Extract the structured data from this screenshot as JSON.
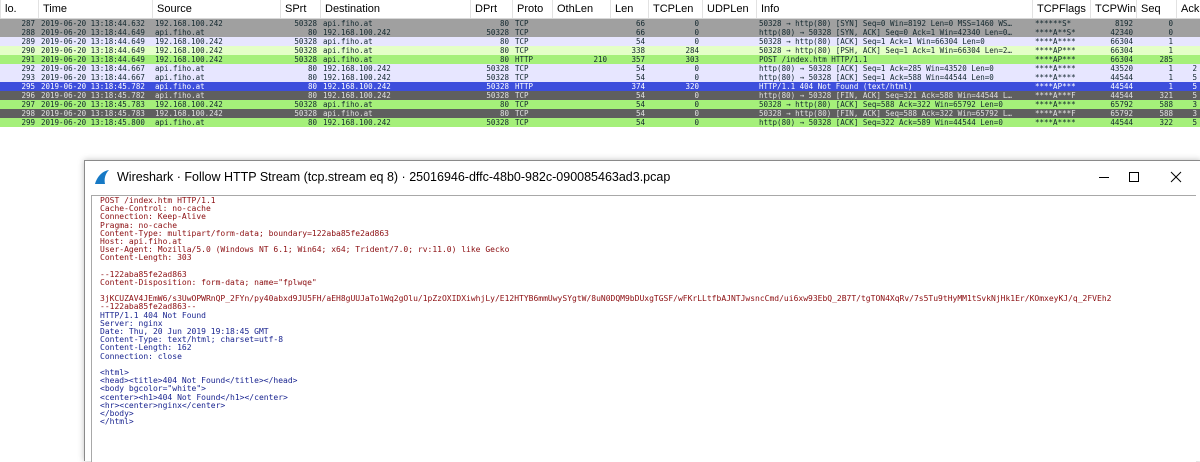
{
  "colors": {
    "client_text": "#8b0d10",
    "server_text": "#1a2590",
    "selected_row": "#3d4edc",
    "http_row_green": "#a5f07a",
    "tcp_row": "#e7e6ff",
    "handshake_row": "#a0a0a0",
    "fin_row": "#5f5f5f"
  },
  "packet_list": {
    "columns": [
      "lo.",
      "Time",
      "Source",
      "SPrt",
      "Destination",
      "DPrt",
      "Proto",
      "OthLen",
      "Len",
      "TCPLen",
      "UDPLen",
      "Info",
      "TCPFlags",
      "TCPWin",
      "Seq",
      "Ack"
    ],
    "rows": [
      {
        "style": "handshake",
        "cells": [
          "287",
          "2019-06-20 13:18:44.632",
          "192.168.100.242",
          "50328",
          "api.fiho.at",
          "80",
          "TCP",
          "",
          "66",
          "0",
          "",
          "50328 → http(80) [SYN] Seq=0 Win=8192 Len=0 MSS=1460 WS…",
          "******S*",
          "8192",
          "0",
          ""
        ]
      },
      {
        "style": "handshake",
        "cells": [
          "288",
          "2019-06-20 13:18:44.649",
          "api.fiho.at",
          "80",
          "192.168.100.242",
          "50328",
          "TCP",
          "",
          "66",
          "0",
          "",
          "http(80) → 50328 [SYN, ACK] Seq=0 Ack=1 Win=42340 Len=0…",
          "****A**S*",
          "42340",
          "0",
          ""
        ]
      },
      {
        "style": "tcp",
        "cells": [
          "289",
          "2019-06-20 13:18:44.649",
          "192.168.100.242",
          "50328",
          "api.fiho.at",
          "80",
          "TCP",
          "",
          "54",
          "0",
          "",
          "50328 → http(80) [ACK] Seq=1 Ack=1 Win=66304 Len=0",
          "****A****",
          "66304",
          "1",
          ""
        ]
      },
      {
        "style": "http",
        "cells": [
          "290",
          "2019-06-20 13:18:44.649",
          "192.168.100.242",
          "50328",
          "api.fiho.at",
          "80",
          "TCP",
          "",
          "338",
          "284",
          "",
          "50328 → http(80) [PSH, ACK] Seq=1 Ack=1 Win=66304 Len=2…",
          "****AP***",
          "66304",
          "1",
          ""
        ]
      },
      {
        "style": "green",
        "cells": [
          "291",
          "2019-06-20 13:18:44.649",
          "192.168.100.242",
          "50328",
          "api.fiho.at",
          "80",
          "HTTP",
          "210",
          "357",
          "303",
          "",
          "POST /index.htm HTTP/1.1",
          "****AP***",
          "66304",
          "285",
          ""
        ]
      },
      {
        "style": "tcp",
        "cells": [
          "292",
          "2019-06-20 13:18:44.667",
          "api.fiho.at",
          "80",
          "192.168.100.242",
          "50328",
          "TCP",
          "",
          "54",
          "0",
          "",
          "http(80) → 50328 [ACK] Seq=1 Ack=285 Win=43520 Len=0",
          "****A****",
          "43520",
          "1",
          "2"
        ]
      },
      {
        "style": "tcp",
        "cells": [
          "293",
          "2019-06-20 13:18:44.667",
          "api.fiho.at",
          "80",
          "192.168.100.242",
          "50328",
          "TCP",
          "",
          "54",
          "0",
          "",
          "http(80) → 50328 [ACK] Seq=1 Ack=588 Win=44544 Len=0",
          "****A****",
          "44544",
          "1",
          "5"
        ]
      },
      {
        "style": "selected",
        "cells": [
          "295",
          "2019-06-20 13:18:45.782",
          "api.fiho.at",
          "80",
          "192.168.100.242",
          "50328",
          "HTTP",
          "",
          "374",
          "320",
          "",
          "HTTP/1.1 404 Not Found  (text/html)",
          "****AP***",
          "44544",
          "1",
          "5"
        ]
      },
      {
        "style": "dark",
        "cells": [
          "296",
          "2019-06-20 13:18:45.782",
          "api.fiho.at",
          "80",
          "192.168.100.242",
          "50328",
          "TCP",
          "",
          "54",
          "0",
          "",
          "http(80) → 50328 [FIN, ACK] Seq=321 Ack=588 Win=44544 L…",
          "****A***F",
          "44544",
          "321",
          "5"
        ]
      },
      {
        "style": "green",
        "cells": [
          "297",
          "2019-06-20 13:18:45.783",
          "192.168.100.242",
          "50328",
          "api.fiho.at",
          "80",
          "TCP",
          "",
          "54",
          "0",
          "",
          "50328 → http(80) [ACK] Seq=588 Ack=322 Win=65792 Len=0",
          "****A****",
          "65792",
          "588",
          "3"
        ]
      },
      {
        "style": "dark",
        "cells": [
          "298",
          "2019-06-20 13:18:45.783",
          "192.168.100.242",
          "50328",
          "api.fiho.at",
          "80",
          "TCP",
          "",
          "54",
          "0",
          "",
          "50328 → http(80) [FIN, ACK] Seq=588 Ack=322 Win=65792 L…",
          "****A***F",
          "65792",
          "588",
          "3"
        ]
      },
      {
        "style": "green",
        "cells": [
          "299",
          "2019-06-20 13:18:45.800",
          "api.fiho.at",
          "80",
          "192.168.100.242",
          "50328",
          "TCP",
          "",
          "54",
          "0",
          "",
          "http(80) → 50328 [ACK] Seq=322 Ack=589 Win=44544 Len=0",
          "****A****",
          "44544",
          "322",
          "5"
        ]
      }
    ]
  },
  "follow_window": {
    "title": "Wireshark · Follow HTTP Stream (tcp.stream eq 8) · 25016946-dffc-48b0-982c-090085463ad3.pcap",
    "app_icon": "wireshark-fin-icon",
    "buttons": {
      "minimize": "minimize-icon",
      "maximize": "maximize-icon",
      "close": "close-icon"
    },
    "stream": [
      {
        "dir": "client",
        "text": "POST /index.htm HTTP/1.1"
      },
      {
        "dir": "client",
        "text": "Cache-Control: no-cache"
      },
      {
        "dir": "client",
        "text": "Connection: Keep-Alive"
      },
      {
        "dir": "client",
        "text": "Pragma: no-cache"
      },
      {
        "dir": "client",
        "text": "Content-Type: multipart/form-data; boundary=122aba85fe2ad863"
      },
      {
        "dir": "client",
        "text": "Host: api.fiho.at"
      },
      {
        "dir": "client",
        "text": "User-Agent: Mozilla/5.0 (Windows NT 6.1; Win64; x64; Trident/7.0; rv:11.0) like Gecko"
      },
      {
        "dir": "client",
        "text": "Content-Length: 303"
      },
      {
        "dir": "client",
        "text": ""
      },
      {
        "dir": "client",
        "text": "--122aba85fe2ad863"
      },
      {
        "dir": "client",
        "text": "Content-Disposition: form-data; name=\"fplwqe\""
      },
      {
        "dir": "client",
        "text": ""
      },
      {
        "dir": "client",
        "text": "3jKCUZAV4JEmW6/s3UwOPWRnQP_2FYn/py40abxd9JU5FH/aEH8gUUJaTo1Wq2gOlu/1pZzOXIDXiwhjLy/E12HTYB6mmUwySYgtW/8uN0DQM9bDUxgTGSF/wFKrLLtfbAJNTJwsncCmd/ui6xw93EbQ_2B7T/tgTON4XqRv/7s5Tu9tHyMM1tSvkNjHk1Er/KOmxeyKJ/q_2FVEh2"
      },
      {
        "dir": "client",
        "text": "--122aba85fe2ad863--"
      },
      {
        "dir": "server",
        "text": "HTTP/1.1 404 Not Found"
      },
      {
        "dir": "server",
        "text": "Server: nginx"
      },
      {
        "dir": "server",
        "text": "Date: Thu, 20 Jun 2019 19:18:45 GMT"
      },
      {
        "dir": "server",
        "text": "Content-Type: text/html; charset=utf-8"
      },
      {
        "dir": "server",
        "text": "Content-Length: 162"
      },
      {
        "dir": "server",
        "text": "Connection: close"
      },
      {
        "dir": "server",
        "text": ""
      },
      {
        "dir": "server",
        "text": "<html>"
      },
      {
        "dir": "server",
        "text": "<head><title>404 Not Found</title></head>"
      },
      {
        "dir": "server",
        "text": "<body bgcolor=\"white\">"
      },
      {
        "dir": "server",
        "text": "<center><h1>404 Not Found</h1></center>"
      },
      {
        "dir": "server",
        "text": "<hr><center>nginx</center>"
      },
      {
        "dir": "server",
        "text": "</body>"
      },
      {
        "dir": "server",
        "text": "</html>"
      }
    ]
  }
}
